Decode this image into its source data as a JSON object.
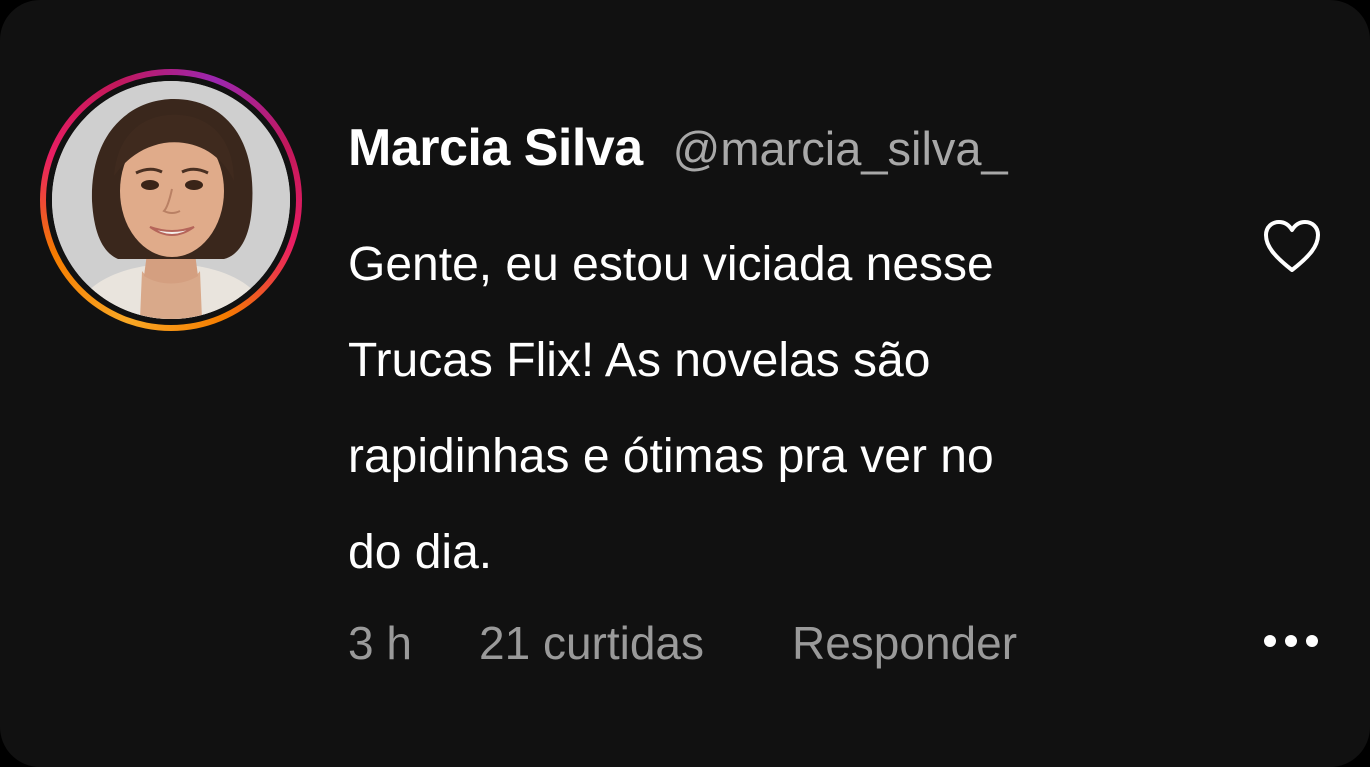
{
  "comment": {
    "author_name": "Marcia Silva",
    "author_handle": "@marcia_silva_",
    "text_lines": [
      "Gente, eu estou viciada nesse",
      "Trucas Flix! As novelas são",
      "rapidinhas e ótimas pra ver no",
      "do dia."
    ],
    "time": "3 h",
    "likes": "21 curtidas",
    "reply_label": "Responder"
  },
  "icons": {
    "like": "heart-icon",
    "more": "more-options-icon",
    "avatar": "profile-photo"
  },
  "colors": {
    "background": "#111111",
    "primary_text": "#ffffff",
    "secondary_text": "#9a9a9a",
    "story_ring_start": "#f9a825",
    "story_ring_end": "#9c27b0"
  }
}
